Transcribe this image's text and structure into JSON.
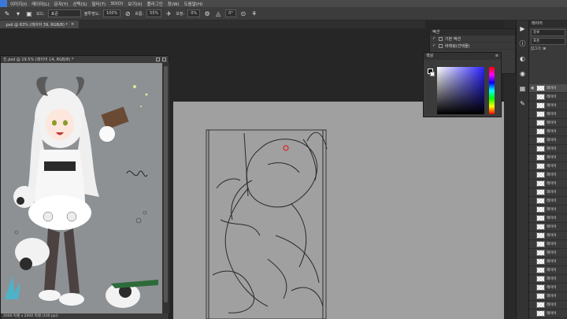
{
  "menu": {
    "items": [
      "이미지(I)",
      "레이어(L)",
      "문자(Y)",
      "선택(S)",
      "필터(T)",
      "3D(D)",
      "보기(V)",
      "플러그인",
      "창(W)",
      "도움말(H)"
    ]
  },
  "options": {
    "mode_label": "모드:",
    "mode_value": "표준",
    "opacity_label": "불투명도:",
    "opacity_value": "100%",
    "flow_label": "흐름:",
    "flow_value": "55%",
    "smoothing_label": "보정:",
    "smoothing_value": "0%",
    "angle_value": "0°"
  },
  "tabs": [
    {
      "label": ".psd @ 63% (레이어 39, RGB/8) *"
    }
  ],
  "reference_window": {
    "title": "진.psd @ 19.5% (레이어 14, RGB/8) *",
    "status": "2000 픽셀 x 2000 픽셀 (100 ppi)"
  },
  "action_panel": {
    "header": "액션",
    "rows": [
      "기본 액션",
      "바테링(선택물)"
    ]
  },
  "color_panel": {
    "header": "색상"
  },
  "layers_panel": {
    "tab": "레이어",
    "search_placeholder": "종류",
    "blend_mode": "표준",
    "lock_label": "잠그기:",
    "layers": [
      "레이어",
      "레이어",
      "레이어",
      "레이어",
      "레이어",
      "레이어",
      "레이어",
      "레이어",
      "레이어",
      "레이어",
      "레이어",
      "레이어",
      "레이어",
      "레이어",
      "레이어",
      "레이어",
      "레이어",
      "레이어",
      "레이어",
      "레이어",
      "레이어",
      "레이어",
      "레이어",
      "레이어",
      "레이어",
      "레이어",
      "레이어"
    ]
  }
}
